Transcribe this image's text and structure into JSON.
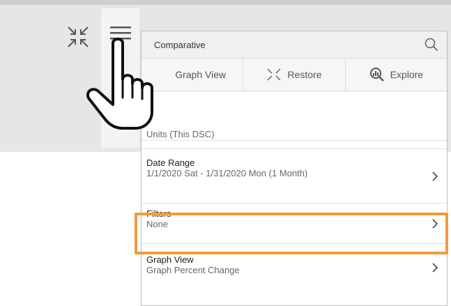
{
  "background_toolbar": {
    "collapse_icon": "collapse-arrows-icon",
    "menu_icon": "hamburger-menu-icon"
  },
  "panel": {
    "title": "Comparative",
    "search_icon": "search-icon",
    "toolbar": [
      {
        "label": "Graph View",
        "icon": "graph-icon"
      },
      {
        "label": "Restore",
        "icon": "restore-icon"
      },
      {
        "label": "Explore",
        "icon": "explore-icon"
      }
    ],
    "units": {
      "value": "Units (This DSC)"
    },
    "date_range": {
      "title": "Date Range",
      "value": "1/1/2020 Sat - 1/31/2020 Mon (1 Month)"
    },
    "filters": {
      "title": "Filters",
      "value": "None"
    },
    "graph_view": {
      "title": "Graph View",
      "value": "Graph Percent Change"
    }
  },
  "colors": {
    "highlight": "#f39a3b",
    "background_band": "#e6e6e6"
  },
  "pointer": "hand-pointer-icon"
}
